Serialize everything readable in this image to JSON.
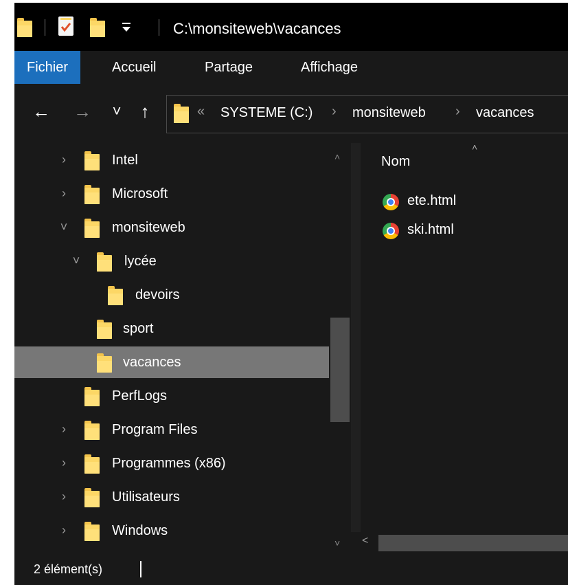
{
  "window": {
    "title": "C:\\monsiteweb\\vacances"
  },
  "title_bar": {
    "icons": [
      "folder-icon",
      "properties-icon",
      "new-folder-icon",
      "customize-dropdown-icon"
    ]
  },
  "ribbon": {
    "tabs": [
      {
        "label": "Fichier",
        "active": true
      },
      {
        "label": "Accueil"
      },
      {
        "label": "Partage"
      },
      {
        "label": "Affichage"
      }
    ]
  },
  "nav": {
    "back": "←",
    "forward": "→",
    "recent": "˅",
    "up": "↑",
    "address": {
      "overflow": "«",
      "crumbs": [
        "SYSTEME (C:)",
        "monsiteweb",
        "vacances"
      ],
      "separator": "›"
    }
  },
  "tree": {
    "items": [
      {
        "label": "Intel",
        "chevron": "›"
      },
      {
        "label": "Microsoft",
        "chevron": "›"
      },
      {
        "label": "monsiteweb",
        "chevron": "˅"
      },
      {
        "label": "lycée",
        "chevron": "˅"
      },
      {
        "label": "devoirs",
        "chevron": ""
      },
      {
        "label": "sport",
        "chevron": ""
      },
      {
        "label": "vacances",
        "chevron": "",
        "selected": true
      },
      {
        "label": "PerfLogs",
        "chevron": ""
      },
      {
        "label": "Program Files",
        "chevron": "›"
      },
      {
        "label": "Programmes (x86)",
        "chevron": "›"
      },
      {
        "label": "Utilisateurs",
        "chevron": "›"
      },
      {
        "label": "Windows",
        "chevron": "›"
      }
    ],
    "scroll_up": "˄",
    "scroll_down": "˅"
  },
  "content": {
    "column_header": "Nom",
    "sort_indicator": "˄",
    "files": [
      {
        "name": "ete.html",
        "icon": "chrome-icon"
      },
      {
        "name": "ski.html",
        "icon": "chrome-icon"
      }
    ],
    "hscroll_left": "<"
  },
  "status": {
    "count": "2 élément(s)"
  },
  "colors": {
    "background": "#191919",
    "title_bar": "#000000",
    "active_tab": "#1c6fbd",
    "selected_row": "#777777",
    "folder": "#fcd766"
  }
}
